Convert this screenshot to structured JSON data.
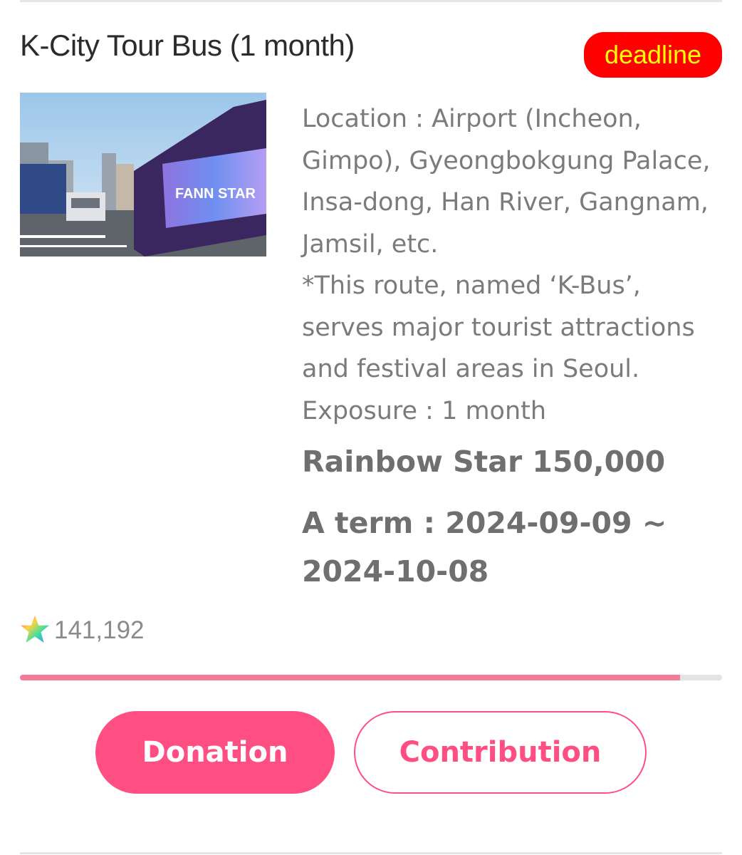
{
  "item": {
    "title": "K-City Tour Bus (1 month)",
    "badge": "deadline",
    "image_alt": "FANN STAR bus wrap",
    "image_brand_text": "FANN STAR",
    "description": [
      "Location : Airport (Incheon, Gimpo), Gyeongbokgung Palace, Insa-dong, Han River, Gangnam, Jamsil, etc.",
      "*This route, named ‘K-Bus’, serves major tourist attractions and festival areas in Seoul.",
      "Exposure : 1 month"
    ],
    "price": "Rainbow Star 150,000",
    "term": "A term : 2024-09-09 ~ 2024-10-08",
    "star_count": "141,192",
    "progress": 0.94
  },
  "actions": {
    "donation_label": "Donation",
    "contribution_label": "Contribution"
  },
  "colors": {
    "accent": "#ff4f82",
    "progress": "#f37b97",
    "badge_bg": "#ff0000",
    "badge_text": "#ffff00"
  },
  "icons": {
    "star": "rainbow-star-icon"
  }
}
